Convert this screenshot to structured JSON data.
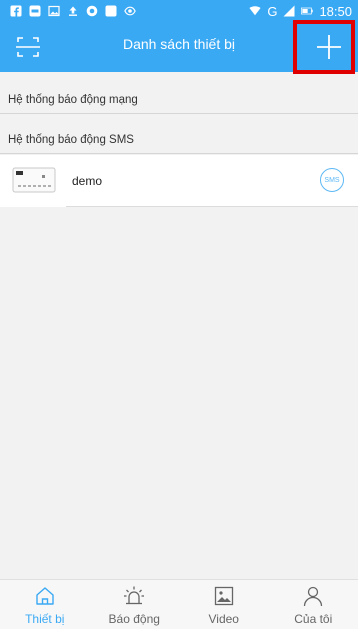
{
  "status_bar": {
    "time": "18:50",
    "icons": [
      "facebook-icon",
      "zalo-icon",
      "image-icon",
      "upload-icon",
      "chrome-icon",
      "app-icon",
      "eye-icon",
      "wifi-icon",
      "signal-icon",
      "battery-icon"
    ],
    "network": "G"
  },
  "header": {
    "title": "Danh sách thiết bị",
    "left_icon": "scan-icon",
    "right_icon": "plus-icon"
  },
  "sections": [
    {
      "label": "Hệ thống báo động mạng"
    },
    {
      "label": "Hệ thống báo động SMS"
    }
  ],
  "devices": [
    {
      "name": "demo",
      "badge": "SMS",
      "thumb_icon": "alarm-panel-icon"
    }
  ],
  "bottom_nav": {
    "items": [
      {
        "label": "Thiết bị",
        "icon": "home-icon",
        "active": true
      },
      {
        "label": "Báo động",
        "icon": "alarm-icon",
        "active": false
      },
      {
        "label": "Video",
        "icon": "picture-icon",
        "active": false
      },
      {
        "label": "Của tôi",
        "icon": "person-icon",
        "active": false
      }
    ]
  },
  "colors": {
    "primary": "#3aa9f4",
    "highlight": "#e10000",
    "background": "#f2f2f2"
  }
}
